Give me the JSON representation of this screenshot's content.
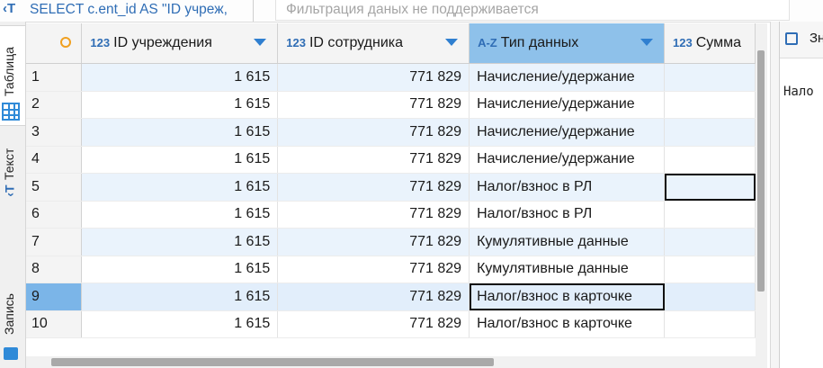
{
  "query_bar": {
    "icon": "sql-text-icon",
    "query_text": "SELECT c.ent_id AS \"ID учреж,",
    "filter_placeholder": "Фильтрация даных не поддерживается"
  },
  "left_tabs": {
    "table_label": "Таблица",
    "text_label": "Текст",
    "record_label": "Запись"
  },
  "grid": {
    "columns": [
      {
        "type_badge": "123",
        "name": "ID учреждения"
      },
      {
        "type_badge": "123",
        "name": "ID сотрудника"
      },
      {
        "type_badge": "A-Z",
        "name": "Тип данных"
      },
      {
        "type_badge": "123",
        "name": "Сумма"
      }
    ],
    "rows": [
      {
        "n": "1",
        "inst": "1 615",
        "emp": "771 829",
        "type": "Начисление/удержание",
        "sum": ""
      },
      {
        "n": "2",
        "inst": "1 615",
        "emp": "771 829",
        "type": "Начисление/удержание",
        "sum": ""
      },
      {
        "n": "3",
        "inst": "1 615",
        "emp": "771 829",
        "type": "Начисление/удержание",
        "sum": ""
      },
      {
        "n": "4",
        "inst": "1 615",
        "emp": "771 829",
        "type": "Начисление/удержание",
        "sum": ""
      },
      {
        "n": "5",
        "inst": "1 615",
        "emp": "771 829",
        "type": "Налог/взнос в РЛ",
        "sum": ""
      },
      {
        "n": "6",
        "inst": "1 615",
        "emp": "771 829",
        "type": "Налог/взнос в РЛ",
        "sum": ""
      },
      {
        "n": "7",
        "inst": "1 615",
        "emp": "771 829",
        "type": "Кумулятивные данные",
        "sum": ""
      },
      {
        "n": "8",
        "inst": "1 615",
        "emp": "771 829",
        "type": "Кумулятивные данные",
        "sum": ""
      },
      {
        "n": "9",
        "inst": "1 615",
        "emp": "771 829",
        "type": "Налог/взнос в карточке",
        "sum": ""
      },
      {
        "n": "10",
        "inst": "1 615",
        "emp": "771 829",
        "type": "Налог/взнос в карточке",
        "sum": ""
      }
    ]
  },
  "value_panel": {
    "title": "Зн",
    "value": "Нало"
  },
  "colors": {
    "accent": "#2f6db5",
    "selected_header": "#8ec1ea",
    "alt_row": "#eaf3fc",
    "selected_row_number": "#7bb5e8"
  }
}
